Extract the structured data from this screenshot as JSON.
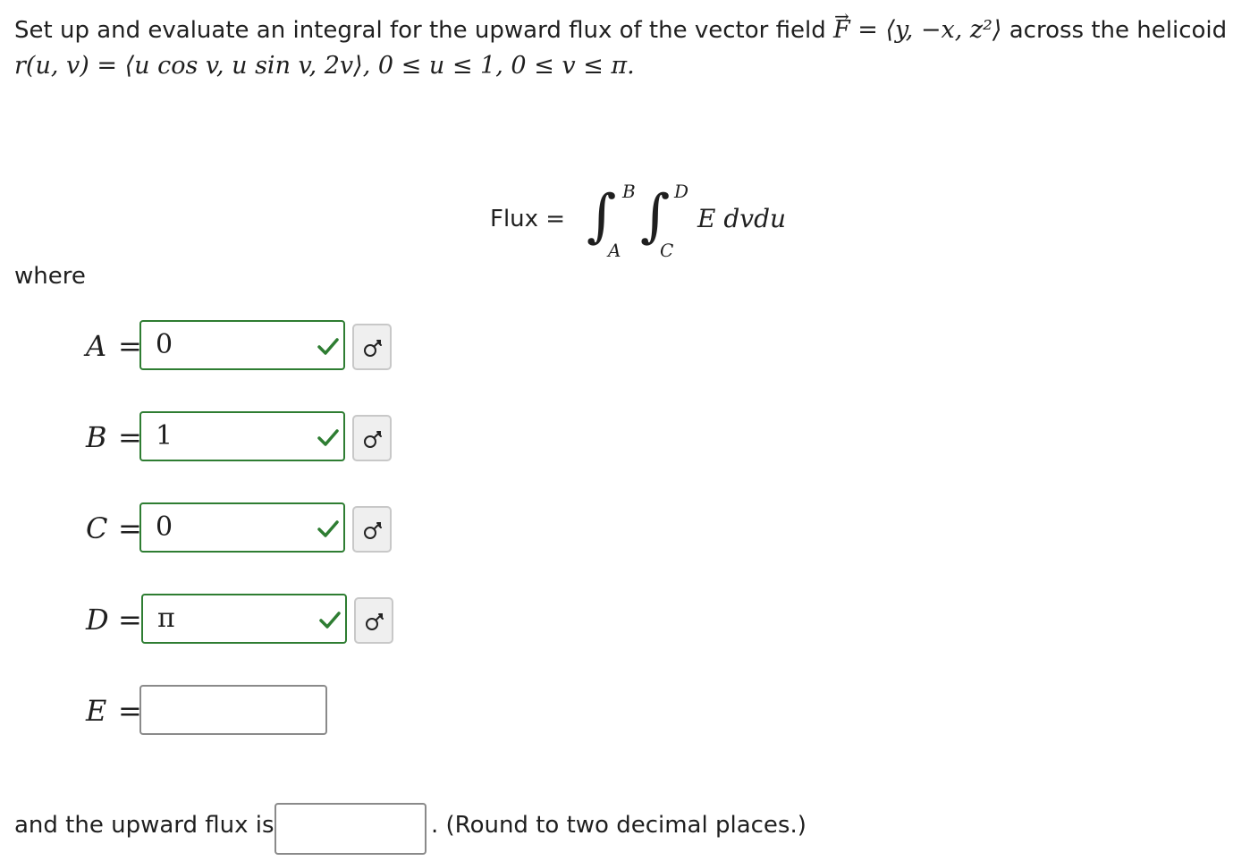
{
  "problem": {
    "intro": "Set up and evaluate an integral for the upward flux of the vector field",
    "field_symbol": "F",
    "field_def": " = ⟨y, −x, z²⟩",
    "after_field": "across the helicoid",
    "surface_def": "r(u, v) = ⟨u cos v, u sin v, 2v⟩,   0 ≤ u ≤ 1,  0 ≤ v ≤ π."
  },
  "flux": {
    "label": "Flux =",
    "upper_outer": "B",
    "lower_outer": "A",
    "upper_inner": "D",
    "lower_inner": "C",
    "integrand": "E dvdu"
  },
  "where_label": "where",
  "answers": [
    {
      "var": "A",
      "value": "0",
      "status": "correct"
    },
    {
      "var": "B",
      "value": "1",
      "status": "correct"
    },
    {
      "var": "C",
      "value": "0",
      "status": "correct"
    },
    {
      "var": "D",
      "value": "π",
      "status": "correct"
    },
    {
      "var": "E",
      "value": "",
      "status": "empty"
    }
  ],
  "final": {
    "label": "and the upward flux is",
    "value": "",
    "note": ". (Round to two decimal places.)"
  },
  "colors": {
    "correct": "#2e7d32",
    "neutral_border": "#8a8a8a"
  },
  "icons": {
    "check": "check-icon",
    "key": "key-icon"
  }
}
